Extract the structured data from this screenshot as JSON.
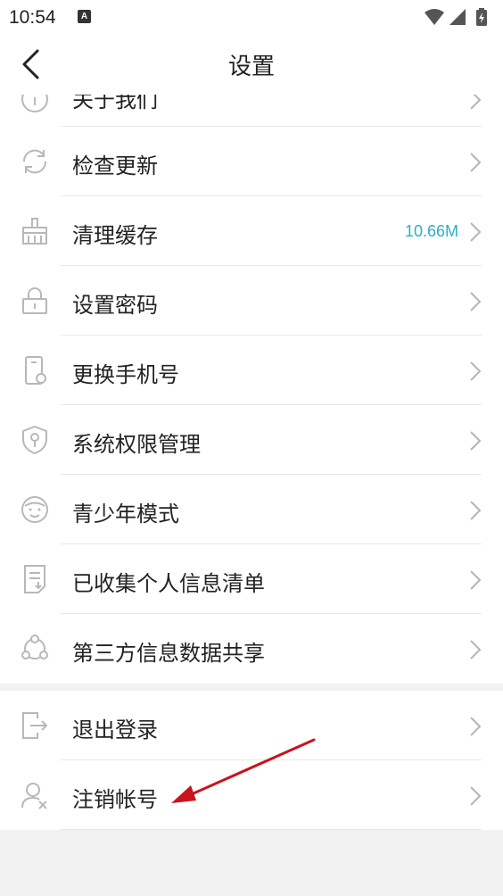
{
  "status_bar": {
    "time": "10:54",
    "notification_icon": "A",
    "icons": [
      "wifi-icon",
      "cellular-signal-icon",
      "battery-charging-icon"
    ]
  },
  "header": {
    "title": "设置",
    "back_icon": "chevron-left-icon"
  },
  "settings": {
    "partial_item": {
      "label": "关于我们",
      "icon": "info-icon"
    },
    "items": [
      {
        "label": "检查更新",
        "icon": "refresh-icon"
      },
      {
        "label": "清理缓存",
        "icon": "broom-icon",
        "value": "10.66M"
      },
      {
        "label": "设置密码",
        "icon": "lock-icon"
      },
      {
        "label": "更换手机号",
        "icon": "phone-icon"
      },
      {
        "label": "系统权限管理",
        "icon": "shield-key-icon"
      },
      {
        "label": "青少年模式",
        "icon": "child-face-icon"
      },
      {
        "label": "已收集个人信息清单",
        "icon": "document-icon"
      },
      {
        "label": "第三方信息数据共享",
        "icon": "share-icon"
      }
    ],
    "account_items": [
      {
        "label": "退出登录",
        "icon": "logout-icon"
      },
      {
        "label": "注销帐号",
        "icon": "delete-user-icon"
      }
    ]
  },
  "colors": {
    "accent_value": "#2ab0c6",
    "annotation_arrow": "#c8141c",
    "background": "#f2f2f2"
  }
}
